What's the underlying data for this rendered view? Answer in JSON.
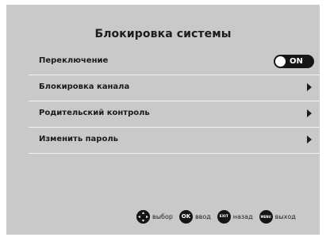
{
  "title": "Блокировка системы",
  "menu": {
    "items": [
      {
        "label": "Переключение",
        "value": "ON"
      },
      {
        "label": "Блокировка канала"
      },
      {
        "label": "Родительский контроль"
      },
      {
        "label": "Изменить пароль"
      }
    ]
  },
  "legend": [
    {
      "icon": "navigation-pad-icon",
      "label": "выбор"
    },
    {
      "icon": "ok-button-icon",
      "key": "OK",
      "label": "ввод"
    },
    {
      "icon": "exit-button-icon",
      "key": "EXIT",
      "label": "назад"
    },
    {
      "icon": "menu-button-icon",
      "key": "MENU",
      "label": "выход"
    }
  ]
}
